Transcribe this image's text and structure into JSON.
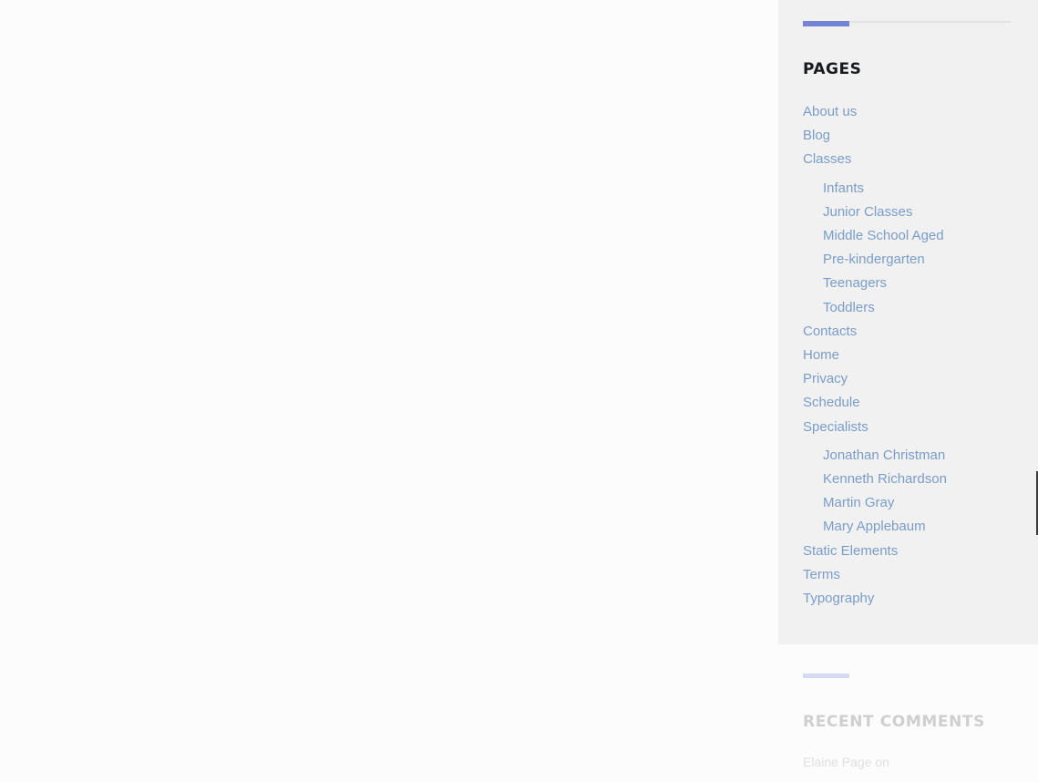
{
  "pages_widget": {
    "title": "PAGES",
    "items": [
      {
        "label": "About us",
        "level": 0
      },
      {
        "label": "Blog",
        "level": 0
      },
      {
        "label": "Classes",
        "level": 0
      },
      {
        "label": "Infants",
        "level": 1
      },
      {
        "label": "Junior Classes",
        "level": 1
      },
      {
        "label": "Middle School Aged",
        "level": 1
      },
      {
        "label": "Pre-kindergarten",
        "level": 1
      },
      {
        "label": "Teenagers",
        "level": 1
      },
      {
        "label": "Toddlers",
        "level": 1
      },
      {
        "label": "Contacts",
        "level": 0
      },
      {
        "label": "Home",
        "level": 0
      },
      {
        "label": "Privacy",
        "level": 0
      },
      {
        "label": "Schedule",
        "level": 0
      },
      {
        "label": "Specialists",
        "level": 0
      },
      {
        "label": "Jonathan Christman",
        "level": 1
      },
      {
        "label": "Kenneth Richardson",
        "level": 1
      },
      {
        "label": "Martin Gray",
        "level": 1
      },
      {
        "label": "Mary Applebaum",
        "level": 1
      },
      {
        "label": "Static Elements",
        "level": 0
      },
      {
        "label": "Terms",
        "level": 0
      },
      {
        "label": "Typography",
        "level": 0
      }
    ]
  },
  "comments_widget": {
    "title": "RECENT COMMENTS",
    "first_comment": "Elaine Page on"
  },
  "colors": {
    "accent": "#7484d4",
    "link": "#7a9dc8",
    "widget_background": "#f1f1f1",
    "page_background": "#fcfcfc",
    "title": "#171a1f"
  }
}
